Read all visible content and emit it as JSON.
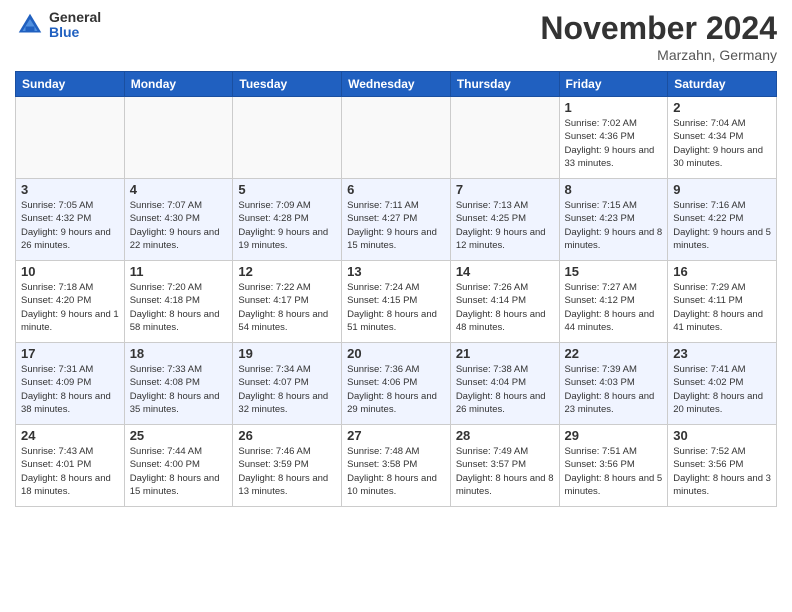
{
  "header": {
    "logo_general": "General",
    "logo_blue": "Blue",
    "month_title": "November 2024",
    "location": "Marzahn, Germany"
  },
  "days_of_week": [
    "Sunday",
    "Monday",
    "Tuesday",
    "Wednesday",
    "Thursday",
    "Friday",
    "Saturday"
  ],
  "weeks": [
    [
      {
        "day": "",
        "info": ""
      },
      {
        "day": "",
        "info": ""
      },
      {
        "day": "",
        "info": ""
      },
      {
        "day": "",
        "info": ""
      },
      {
        "day": "",
        "info": ""
      },
      {
        "day": "1",
        "info": "Sunrise: 7:02 AM\nSunset: 4:36 PM\nDaylight: 9 hours and 33 minutes."
      },
      {
        "day": "2",
        "info": "Sunrise: 7:04 AM\nSunset: 4:34 PM\nDaylight: 9 hours and 30 minutes."
      }
    ],
    [
      {
        "day": "3",
        "info": "Sunrise: 7:05 AM\nSunset: 4:32 PM\nDaylight: 9 hours and 26 minutes."
      },
      {
        "day": "4",
        "info": "Sunrise: 7:07 AM\nSunset: 4:30 PM\nDaylight: 9 hours and 22 minutes."
      },
      {
        "day": "5",
        "info": "Sunrise: 7:09 AM\nSunset: 4:28 PM\nDaylight: 9 hours and 19 minutes."
      },
      {
        "day": "6",
        "info": "Sunrise: 7:11 AM\nSunset: 4:27 PM\nDaylight: 9 hours and 15 minutes."
      },
      {
        "day": "7",
        "info": "Sunrise: 7:13 AM\nSunset: 4:25 PM\nDaylight: 9 hours and 12 minutes."
      },
      {
        "day": "8",
        "info": "Sunrise: 7:15 AM\nSunset: 4:23 PM\nDaylight: 9 hours and 8 minutes."
      },
      {
        "day": "9",
        "info": "Sunrise: 7:16 AM\nSunset: 4:22 PM\nDaylight: 9 hours and 5 minutes."
      }
    ],
    [
      {
        "day": "10",
        "info": "Sunrise: 7:18 AM\nSunset: 4:20 PM\nDaylight: 9 hours and 1 minute."
      },
      {
        "day": "11",
        "info": "Sunrise: 7:20 AM\nSunset: 4:18 PM\nDaylight: 8 hours and 58 minutes."
      },
      {
        "day": "12",
        "info": "Sunrise: 7:22 AM\nSunset: 4:17 PM\nDaylight: 8 hours and 54 minutes."
      },
      {
        "day": "13",
        "info": "Sunrise: 7:24 AM\nSunset: 4:15 PM\nDaylight: 8 hours and 51 minutes."
      },
      {
        "day": "14",
        "info": "Sunrise: 7:26 AM\nSunset: 4:14 PM\nDaylight: 8 hours and 48 minutes."
      },
      {
        "day": "15",
        "info": "Sunrise: 7:27 AM\nSunset: 4:12 PM\nDaylight: 8 hours and 44 minutes."
      },
      {
        "day": "16",
        "info": "Sunrise: 7:29 AM\nSunset: 4:11 PM\nDaylight: 8 hours and 41 minutes."
      }
    ],
    [
      {
        "day": "17",
        "info": "Sunrise: 7:31 AM\nSunset: 4:09 PM\nDaylight: 8 hours and 38 minutes."
      },
      {
        "day": "18",
        "info": "Sunrise: 7:33 AM\nSunset: 4:08 PM\nDaylight: 8 hours and 35 minutes."
      },
      {
        "day": "19",
        "info": "Sunrise: 7:34 AM\nSunset: 4:07 PM\nDaylight: 8 hours and 32 minutes."
      },
      {
        "day": "20",
        "info": "Sunrise: 7:36 AM\nSunset: 4:06 PM\nDaylight: 8 hours and 29 minutes."
      },
      {
        "day": "21",
        "info": "Sunrise: 7:38 AM\nSunset: 4:04 PM\nDaylight: 8 hours and 26 minutes."
      },
      {
        "day": "22",
        "info": "Sunrise: 7:39 AM\nSunset: 4:03 PM\nDaylight: 8 hours and 23 minutes."
      },
      {
        "day": "23",
        "info": "Sunrise: 7:41 AM\nSunset: 4:02 PM\nDaylight: 8 hours and 20 minutes."
      }
    ],
    [
      {
        "day": "24",
        "info": "Sunrise: 7:43 AM\nSunset: 4:01 PM\nDaylight: 8 hours and 18 minutes."
      },
      {
        "day": "25",
        "info": "Sunrise: 7:44 AM\nSunset: 4:00 PM\nDaylight: 8 hours and 15 minutes."
      },
      {
        "day": "26",
        "info": "Sunrise: 7:46 AM\nSunset: 3:59 PM\nDaylight: 8 hours and 13 minutes."
      },
      {
        "day": "27",
        "info": "Sunrise: 7:48 AM\nSunset: 3:58 PM\nDaylight: 8 hours and 10 minutes."
      },
      {
        "day": "28",
        "info": "Sunrise: 7:49 AM\nSunset: 3:57 PM\nDaylight: 8 hours and 8 minutes."
      },
      {
        "day": "29",
        "info": "Sunrise: 7:51 AM\nSunset: 3:56 PM\nDaylight: 8 hours and 5 minutes."
      },
      {
        "day": "30",
        "info": "Sunrise: 7:52 AM\nSunset: 3:56 PM\nDaylight: 8 hours and 3 minutes."
      }
    ]
  ]
}
